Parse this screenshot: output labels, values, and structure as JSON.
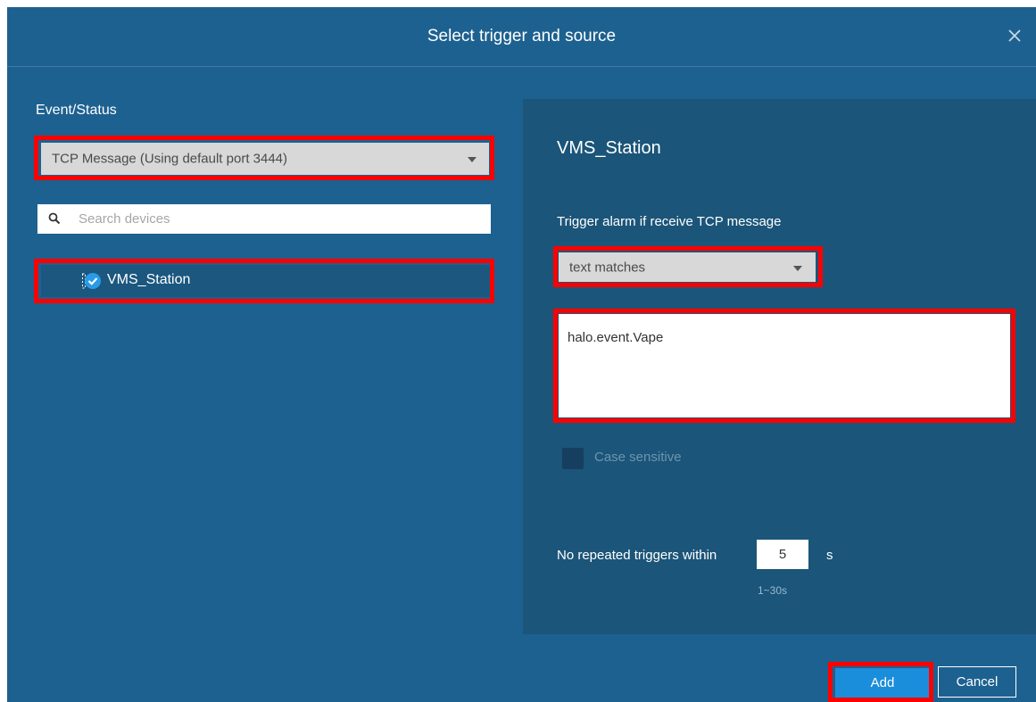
{
  "dialog": {
    "title": "Select trigger and source"
  },
  "left": {
    "section_label": "Event/Status",
    "event_select": {
      "selected": "TCP Message (Using default port 3444)"
    },
    "search": {
      "placeholder": "Search devices"
    },
    "devices": [
      {
        "name": "VMS_Station",
        "checked": true
      }
    ]
  },
  "right": {
    "device_title": "VMS_Station",
    "trigger_label": "Trigger alarm if receive TCP message",
    "match_select": {
      "selected": "text matches"
    },
    "message_text": "halo.event.Vape",
    "case_sensitive": {
      "label": "Case sensitive",
      "checked": false
    },
    "repeat": {
      "label": "No repeated triggers within",
      "value": "5",
      "unit": "s",
      "range_hint": "1~30s"
    }
  },
  "buttons": {
    "add": "Add",
    "cancel": "Cancel"
  },
  "colors": {
    "dialog_bg": "#1d6190",
    "panel_bg": "#1b5579",
    "highlight_border": "#ff0000",
    "primary_button": "#1b8edb"
  }
}
